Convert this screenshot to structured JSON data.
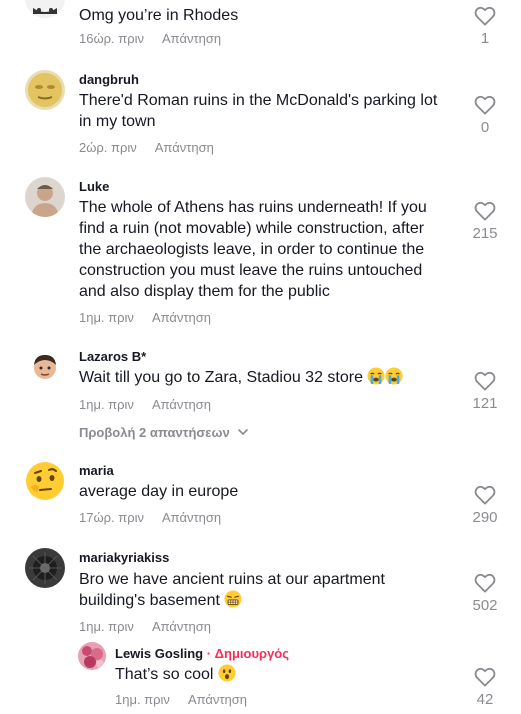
{
  "comments": [
    {
      "username": "",
      "text": "Omg you’re in Rhodes",
      "time": "16ώρ. πριν",
      "reply_label": "Απάντηση",
      "likes": "1"
    },
    {
      "username": "dangbruh",
      "text": "There'd Roman ruins in the McDonald's parking lot in my town",
      "time": "2ώρ. πριν",
      "reply_label": "Απάντηση",
      "likes": "0"
    },
    {
      "username": "Luke",
      "text": "The whole of Athens has ruins underneath! If you find a ruin (not movable) while construction, after the archaeologists leave, in order to continue the construction you must leave the ruins untouched and also display them for the public",
      "time": "1ημ. πριν",
      "reply_label": "Απάντηση",
      "likes": "215"
    },
    {
      "username": "Lazaros B*",
      "text": "Wait till you go to Zara, Stadiou 32 store",
      "time": "1ημ. πριν",
      "reply_label": "Απάντηση",
      "likes": "121",
      "view_replies": "Προβολή 2 απαντήσεων"
    },
    {
      "username": "maria",
      "text": "average day in europe",
      "time": "17ώρ. πριν",
      "reply_label": "Απάντηση",
      "likes": "290"
    },
    {
      "username": "mariakyriakiss",
      "text": "Bro we have ancient ruins at our apartment building's basement",
      "time": "1ημ. πριν",
      "reply_label": "Απάντηση",
      "likes": "502"
    },
    {
      "username": "Lewis Gosling",
      "creator_label": " · Δημιουργός",
      "text": "That’s so cool",
      "time": "1ημ. πριν",
      "reply_label": "Απάντηση",
      "likes": "42"
    }
  ],
  "icons": {
    "like": "heart-outline-icon",
    "expand": "chevron-down-icon",
    "loudly_crying": "loudly-crying-face-emoji",
    "grimacing": "grimacing-face-emoji",
    "surprised": "surprised-face-emoji"
  },
  "colors": {
    "text": "#161823",
    "secondary": "#8a8b91",
    "creator": "#fe2c55"
  }
}
